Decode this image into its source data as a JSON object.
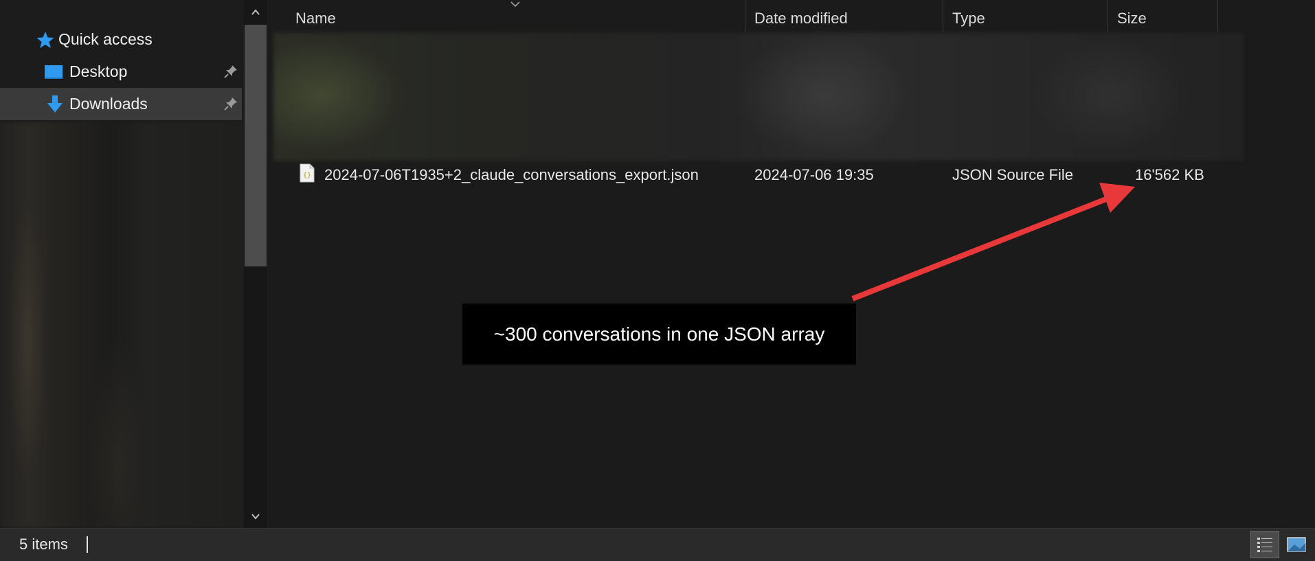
{
  "navigation": {
    "items": [
      {
        "label": "Quick access",
        "icon": "star-icon"
      },
      {
        "label": "Desktop",
        "icon": "desktop-icon",
        "pinned": true
      },
      {
        "label": "Downloads",
        "icon": "download-arrow-icon",
        "pinned": true,
        "selected": true
      }
    ]
  },
  "file_list": {
    "columns": [
      "Name",
      "Date modified",
      "Type",
      "Size"
    ],
    "rows": [
      {
        "name": "2024-07-06T1935+2_claude_conversations_export.json",
        "date_modified": "2024-07-06 19:35",
        "type": "JSON Source File",
        "size": "16'562 KB",
        "icon": "json-file-icon"
      }
    ]
  },
  "annotation": {
    "text": "~300 conversations in one JSON array",
    "arrow_color": "#e8383a"
  },
  "status_bar": {
    "item_count": "5 items"
  },
  "colors": {
    "background": "#1b1b1b",
    "selected_nav": "#3a3a3a",
    "accent_blue": "#2f9bf0"
  }
}
